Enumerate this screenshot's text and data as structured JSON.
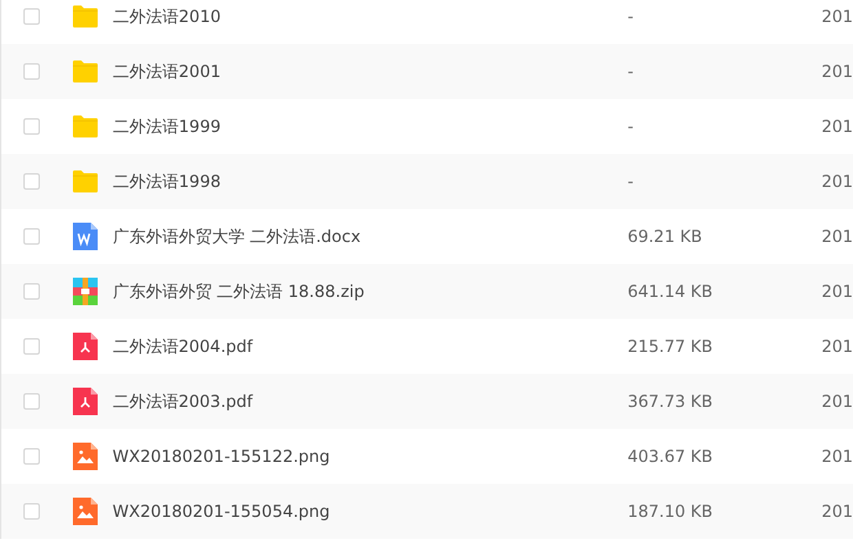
{
  "files": [
    {
      "kind": "folder",
      "name": "二外法语2010",
      "size": "-",
      "date": "201",
      "checked": false
    },
    {
      "kind": "folder",
      "name": "二外法语2001",
      "size": "-",
      "date": "201",
      "checked": false
    },
    {
      "kind": "folder",
      "name": "二外法语1999",
      "size": "-",
      "date": "201",
      "checked": false
    },
    {
      "kind": "folder",
      "name": "二外法语1998",
      "size": "-",
      "date": "201",
      "checked": false
    },
    {
      "kind": "word",
      "name": "广东外语外贸大学 二外法语.docx",
      "size": "69.21 KB",
      "date": "201",
      "checked": false
    },
    {
      "kind": "zip",
      "name": "广东外语外贸 二外法语 18.88.zip",
      "size": "641.14 KB",
      "date": "201",
      "checked": false
    },
    {
      "kind": "pdf",
      "name": "二外法语2004.pdf",
      "size": "215.77 KB",
      "date": "201",
      "checked": false
    },
    {
      "kind": "pdf",
      "name": "二外法语2003.pdf",
      "size": "367.73 KB",
      "date": "201",
      "checked": false
    },
    {
      "kind": "image",
      "name": "WX20180201-155122.png",
      "size": "403.67 KB",
      "date": "201",
      "checked": false
    },
    {
      "kind": "image",
      "name": "WX20180201-155054.png",
      "size": "187.10 KB",
      "date": "201",
      "checked": false
    }
  ]
}
